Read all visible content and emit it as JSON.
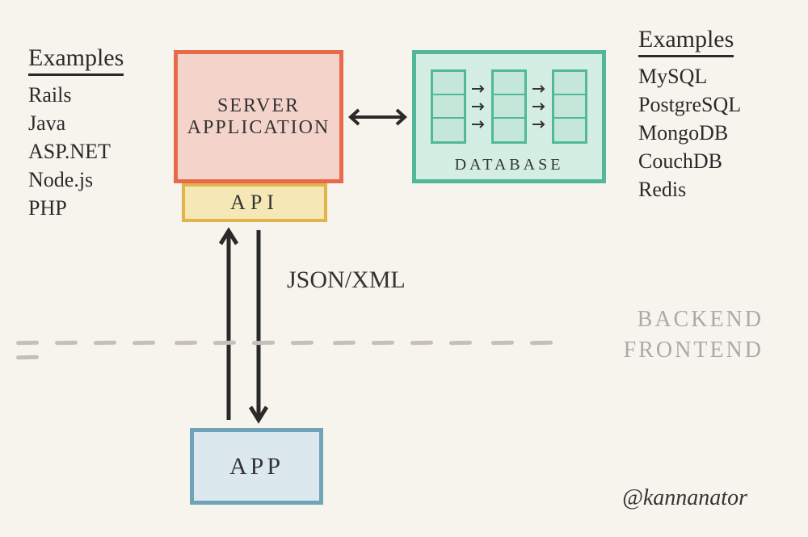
{
  "left_examples": {
    "header": "Examples",
    "items": [
      "Rails",
      "Java",
      "ASP.NET",
      "Node.js",
      "PHP"
    ]
  },
  "right_examples": {
    "header": "Examples",
    "items": [
      "MySQL",
      "PostgreSQL",
      "MongoDB",
      "CouchDB",
      "Redis"
    ]
  },
  "server_box": {
    "label": "SERVER\nAPPLICATION"
  },
  "api_box": {
    "label": "API"
  },
  "database_box": {
    "label": "DATABASE"
  },
  "app_box": {
    "label": "APP"
  },
  "connection_label": "JSON/XML",
  "section_labels": {
    "backend": "BACKEND",
    "frontend": "FRONTEND"
  },
  "credit": "@kannanator"
}
